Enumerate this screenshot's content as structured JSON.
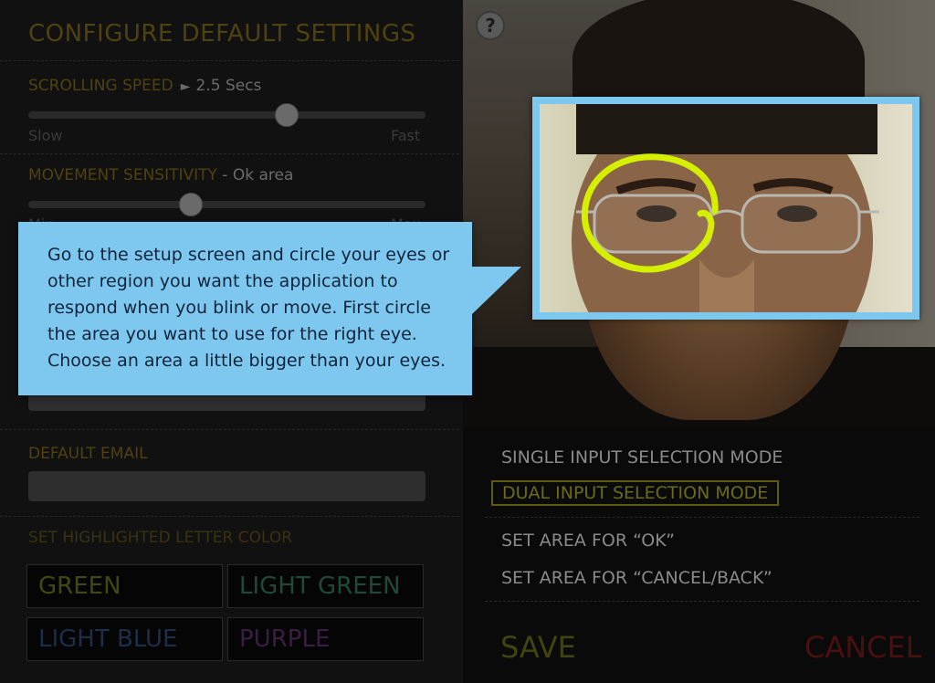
{
  "settings": {
    "title": "CONFIGURE DEFAULT SETTINGS",
    "scrolling_speed": {
      "label": "SCROLLING SPEED",
      "value": "2.5 Secs",
      "min_label": "Slow",
      "max_label": "Fast",
      "level": 0.65
    },
    "movement_sensitivity": {
      "label": "MOVEMENT SENSITIVITY",
      "separator": " - ",
      "value": "Ok area",
      "min_label": "Min",
      "max_label": "Max",
      "level": 0.41
    },
    "default_email_label": "DEFAULT EMAIL",
    "highlight_color_label": "SET HIGHLIGHTED LETTER COLOR",
    "colors": [
      {
        "label": "GREEN",
        "color": "#3f4a10"
      },
      {
        "label": "LIGHT GREEN",
        "color": "#1f4a38"
      },
      {
        "label": "LIGHT BLUE",
        "color": "#1c2e48"
      },
      {
        "label": "PURPLE",
        "color": "#3a1e44"
      }
    ]
  },
  "camera": {
    "help_label": "?"
  },
  "modes": {
    "single_input": "SINGLE INPUT SELECTION MODE",
    "dual_input": "DUAL INPUT SELECTION MODE",
    "set_area_ok": "SET AREA FOR “OK”",
    "set_area_cancel": "SET AREA FOR “CANCEL/BACK”"
  },
  "actions": {
    "save": "SAVE",
    "cancel": "CANCEL",
    "save_color": "#3f4410",
    "cancel_color": "#4a1010"
  },
  "callout": {
    "text": "Go to the setup screen and circle your eyes or other region you want the application to respond when you blink or move. First circle the area you want to use for the right eye. Choose an area a little bigger than your eyes."
  },
  "colors": {
    "highlight_ring": "#d4f000",
    "callout_bg": "#7ec8f0"
  }
}
